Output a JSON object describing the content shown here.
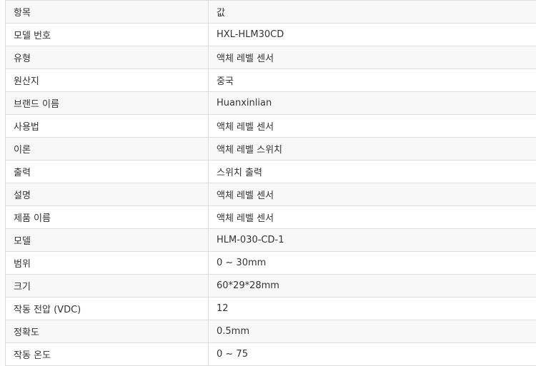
{
  "table": {
    "headers": [
      "항목",
      "값"
    ],
    "rows": [
      [
        "모델 번호",
        "HXL-HLM30CD"
      ],
      [
        "유형",
        "액체 레벨 센서"
      ],
      [
        "원산지",
        "중국"
      ],
      [
        "브랜드 이름",
        "Huanxinlian"
      ],
      [
        "사용법",
        "액체 레벨 센서"
      ],
      [
        "이론",
        "액체 레벨 스위치"
      ],
      [
        "출력",
        "스위치 출력"
      ],
      [
        "설명",
        "액체 레벨 센서"
      ],
      [
        "제품 이름",
        "액체 레벨 센서"
      ],
      [
        "모델",
        "HLM-030-CD-1"
      ],
      [
        "범위",
        "0 ~ 30mm"
      ],
      [
        "크기",
        "60*29*28mm"
      ],
      [
        "작동 전압 (VDC)",
        "12"
      ],
      [
        "정확도",
        "0.5mm"
      ],
      [
        "작동 온도",
        "0 ~ 75"
      ]
    ]
  }
}
